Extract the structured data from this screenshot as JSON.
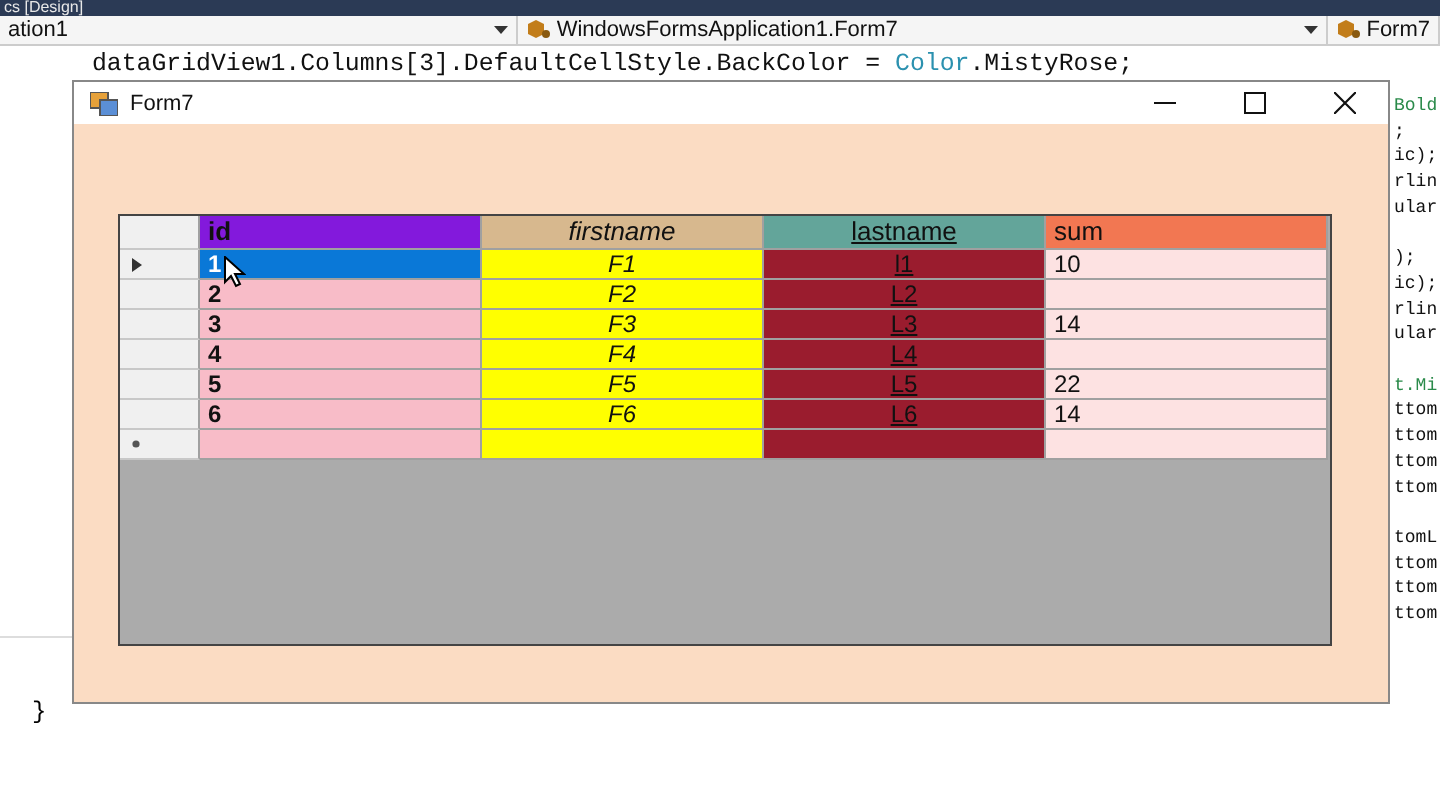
{
  "editor": {
    "tab": "cs [Design]",
    "nav": [
      {
        "label": "ation1"
      },
      {
        "label": "WindowsFormsApplication1.Form7"
      },
      {
        "label": "Form7"
      }
    ],
    "code_line": {
      "before": "dataGridView1.Columns[3].DefaultCellStyle.BackColor = ",
      "type": "Color",
      "after": ".MistyRose;"
    },
    "side_code": [
      [
        "Bold",
        ";",
        "ic);",
        "rlin",
        "ular"
      ],
      [
        ");",
        "ic);",
        "rlin",
        "ular"
      ],
      [
        "t.Mi",
        "ttom",
        "ttom",
        "ttom",
        "ttom"
      ],
      [
        "tomL",
        "ttom",
        "ttom",
        "ttom"
      ]
    ],
    "closing_brace": "}"
  },
  "window": {
    "title": "Form7"
  },
  "grid": {
    "columns": [
      {
        "name": "id",
        "kind": "bold",
        "color": "#8319dc",
        "cells": {
          "color": "#f8bcc8"
        }
      },
      {
        "name": "firstname",
        "kind": "italic",
        "color": "#d7b88e",
        "cells": {
          "color": "#ffff00"
        }
      },
      {
        "name": "lastname",
        "kind": "underline",
        "color": "#63a59a",
        "cells": {
          "color": "#9a1c2e"
        }
      },
      {
        "name": "sum",
        "kind": "plain",
        "color": "#f27752",
        "cells": {
          "color": "#fde2e2"
        }
      }
    ],
    "rows": [
      {
        "kind": "data",
        "selected": true,
        "cells": [
          "1",
          "F1",
          "l1",
          "10"
        ]
      },
      {
        "kind": "data",
        "selected": false,
        "cells": [
          "2",
          "F2",
          "L2",
          ""
        ]
      },
      {
        "kind": "data",
        "selected": false,
        "cells": [
          "3",
          "F3",
          "L3",
          "14"
        ]
      },
      {
        "kind": "data",
        "selected": false,
        "cells": [
          "4",
          "F4",
          "L4",
          ""
        ]
      },
      {
        "kind": "data",
        "selected": false,
        "cells": [
          "5",
          "F5",
          "L5",
          "22"
        ]
      },
      {
        "kind": "data",
        "selected": false,
        "cells": [
          "6",
          "F6",
          "L6",
          "14"
        ]
      },
      {
        "kind": "new",
        "selected": false,
        "cells": [
          "",
          "",
          "",
          ""
        ]
      }
    ]
  }
}
